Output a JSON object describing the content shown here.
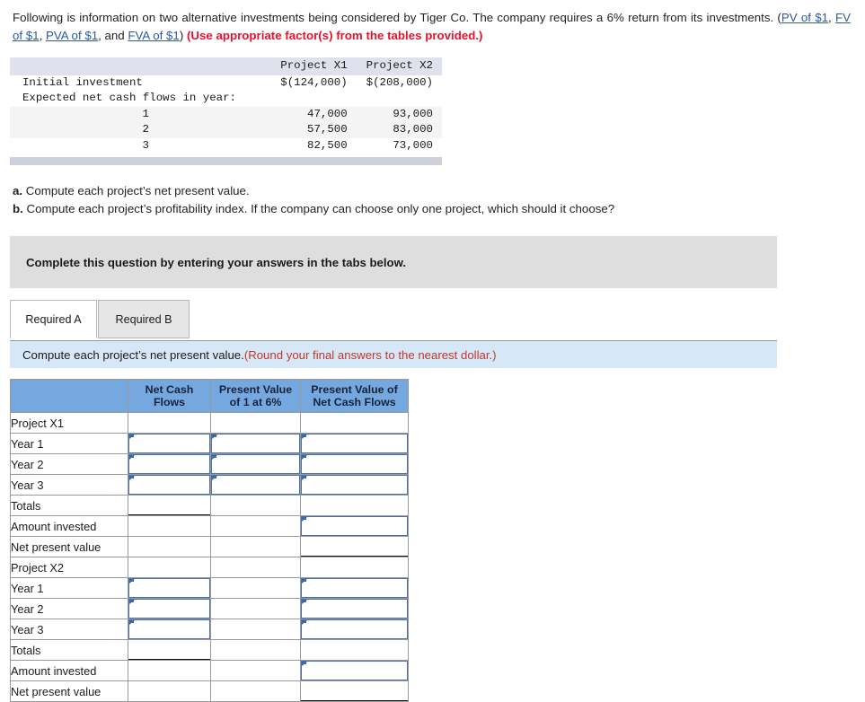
{
  "intro": {
    "text_1": "Following is information on two alternative investments being considered by Tiger Co. The company requires a 6% return from its investments. (",
    "link_pv": "PV of $1",
    "sep_1": ", ",
    "link_fv": "FV of $1",
    "sep_2": ", ",
    "link_pva": "PVA of $1",
    "sep_3": ", and ",
    "link_fva": "FVA of $1",
    "sep_4": ") ",
    "red_note": "(Use appropriate factor(s) from the tables provided.)"
  },
  "data_table": {
    "columns": [
      "",
      "Project X1",
      "Project X2"
    ],
    "rows": [
      {
        "label": "Initial investment",
        "x1": "$(124,000)",
        "x2": "$(208,000)",
        "shade": false
      },
      {
        "label": "Expected net cash flows in year:",
        "x1": "",
        "x2": "",
        "shade": false
      },
      {
        "label": "1",
        "x1": "47,000",
        "x2": "93,000",
        "shade": true
      },
      {
        "label": "2",
        "x1": "57,500",
        "x2": "83,000",
        "shade": true
      },
      {
        "label": "3",
        "x1": "82,500",
        "x2": "73,000",
        "shade": false
      }
    ]
  },
  "questions": {
    "a_marker": "a.",
    "a_text": " Compute each project’s net present value.",
    "b_marker": "b.",
    "b_text": " Compute each project’s profitability index. If the company can choose only one project, which should it choose?"
  },
  "gray_panel": {
    "text": "Complete this question by entering your answers in the tabs below."
  },
  "tabs": [
    {
      "label": "Required A",
      "active": true
    },
    {
      "label": "Required B",
      "active": false
    }
  ],
  "blue_strip": {
    "text": "Compute each project’s net present value. ",
    "red_note": "(Round your final answers to the nearest dollar.)"
  },
  "answer_grid": {
    "headers": [
      "",
      "Net Cash Flows",
      "Present Value of 1 at 6%",
      "Present Value of Net Cash Flows"
    ],
    "headers_wrapped": [
      {
        "line1": "",
        "line2": ""
      },
      {
        "line1": "Net Cash",
        "line2": "Flows"
      },
      {
        "line1": "Present Value",
        "line2": "of 1 at 6%"
      },
      {
        "line1": "Present Value of",
        "line2": "Net Cash Flows"
      }
    ],
    "rows": [
      {
        "label": "Project X1",
        "c1": "",
        "c2": "",
        "c3": ""
      },
      {
        "label": "Year 1",
        "c1": "",
        "c2": "",
        "c3": ""
      },
      {
        "label": "Year 2",
        "c1": "",
        "c2": "",
        "c3": ""
      },
      {
        "label": "Year 3",
        "c1": "",
        "c2": "",
        "c3": ""
      },
      {
        "label": "Totals",
        "c1": "",
        "c2": "",
        "c3": ""
      },
      {
        "label": "Amount invested",
        "c1": "",
        "c2": "",
        "c3": ""
      },
      {
        "label": "Net present value",
        "c1": "",
        "c2": "",
        "c3": ""
      },
      {
        "label": "Project X2",
        "c1": "",
        "c2": "",
        "c3": ""
      },
      {
        "label": "Year 1",
        "c1": "",
        "c2": "",
        "c3": ""
      },
      {
        "label": "Year 2",
        "c1": "",
        "c2": "",
        "c3": ""
      },
      {
        "label": "Year 3",
        "c1": "",
        "c2": "",
        "c3": ""
      },
      {
        "label": "Totals",
        "c1": "",
        "c2": "",
        "c3": ""
      },
      {
        "label": "Amount invested",
        "c1": "",
        "c2": "",
        "c3": ""
      },
      {
        "label": "Net present value",
        "c1": "",
        "c2": "",
        "c3": ""
      }
    ]
  },
  "colors": {
    "header_blue": "#76a8e0",
    "strip_blue": "#d6e8f7",
    "gray_panel": "#dedede",
    "link_blue": "#2c5aa0",
    "red": "#e8112d",
    "input_border": "#4a72a8",
    "data_header": "#dfe2ec",
    "data_bottom_bar": "#ced1db"
  }
}
